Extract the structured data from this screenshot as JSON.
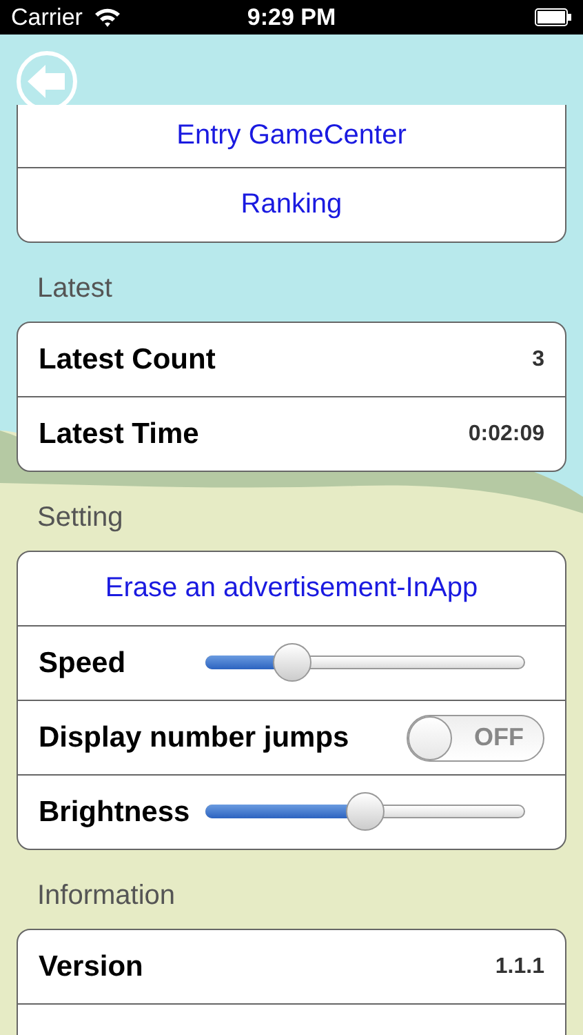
{
  "status_bar": {
    "carrier": "Carrier",
    "time": "9:29 PM"
  },
  "sections": [
    {
      "rows": [
        {
          "kind": "action",
          "label": "Entry GameCenter"
        },
        {
          "kind": "action",
          "label": "Ranking"
        }
      ]
    },
    {
      "title": "Latest",
      "rows": [
        {
          "kind": "value",
          "label": "Latest Count",
          "value": "3"
        },
        {
          "kind": "value",
          "label": "Latest Time",
          "value": "0:02:09"
        }
      ]
    },
    {
      "title": "Setting",
      "rows": [
        {
          "kind": "action",
          "label": "Erase an advertisement-InApp"
        },
        {
          "kind": "slider",
          "label": "Speed",
          "level": 0.24
        },
        {
          "kind": "switch",
          "label": "Display number jumps",
          "on": false,
          "state_text": "OFF"
        },
        {
          "kind": "slider",
          "label": "Brightness",
          "level": 0.5
        }
      ]
    },
    {
      "title": "Information",
      "rows": [
        {
          "kind": "value",
          "label": "Version",
          "value": "1.1.1"
        },
        {
          "kind": "blank"
        }
      ]
    }
  ]
}
